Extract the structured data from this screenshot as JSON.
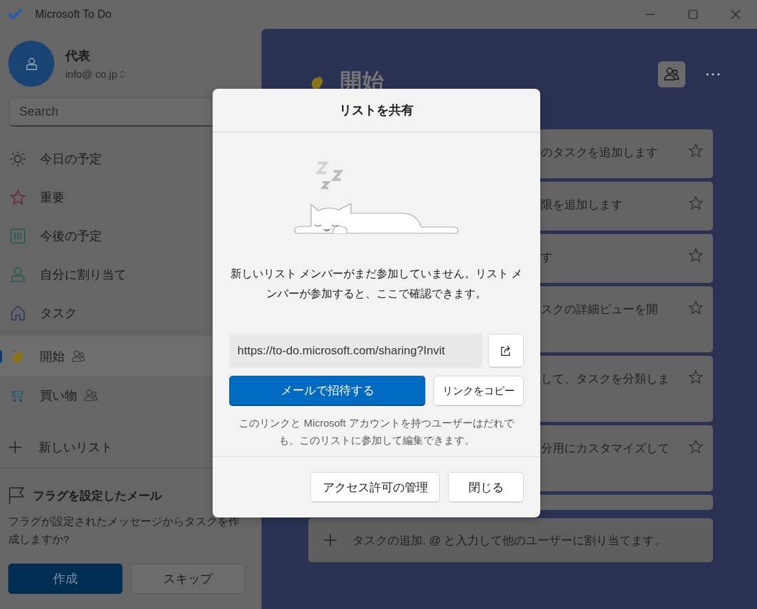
{
  "window": {
    "title": "Microsoft To Do"
  },
  "sidebar": {
    "account": {
      "name": "代表",
      "email": "info@ co.jp"
    },
    "search": {
      "placeholder": "Search"
    },
    "items": [
      {
        "kind": "sun",
        "label": "今日の予定",
        "selected": false,
        "shared": false
      },
      {
        "kind": "star",
        "label": "重要",
        "selected": false,
        "shared": false
      },
      {
        "kind": "calendar",
        "label": "今後の予定",
        "selected": false,
        "shared": false
      },
      {
        "kind": "person",
        "label": "自分に割り当て",
        "selected": false,
        "shared": false
      },
      {
        "kind": "home",
        "label": "タスク",
        "selected": false,
        "shared": false
      },
      {
        "kind": "wave",
        "label": "開始",
        "selected": true,
        "shared": true
      },
      {
        "kind": "cart",
        "label": "買い物",
        "selected": false,
        "shared": true
      }
    ],
    "new_list": "新しいリスト",
    "flagged": {
      "title": "フラグを設定したメール",
      "message": "フラグが設定されたメッセージからタスクを作成しますか?",
      "buttons": [
        {
          "label": "作成",
          "primary": true
        },
        {
          "label": "スキップ",
          "primary": false
        }
      ]
    }
  },
  "main": {
    "title": "開始",
    "tasks": [
      {
        "text": "のタスクを追加します"
      },
      {
        "text": "限を追加します"
      },
      {
        "text": "す"
      },
      {
        "text": "スクの詳細ビューを開"
      },
      {
        "text": "して、タスクを分類しま"
      },
      {
        "text": "分用にカスタマイズして"
      }
    ],
    "add_task": "タスクの追加. @ と入力して他のユーザーに割り当てます。"
  },
  "dialog": {
    "title": "リストを共有",
    "message": "新しいリスト メンバーがまだ参加していません。リスト メンバーが参加すると、ここで確認できます。",
    "link": "https://to-do.microsoft.com/sharing?Invit",
    "invite_button": "メールで招待する",
    "copy_button": "リンクをコピー",
    "note": "このリンクと Microsoft アカウントを持つユーザーはだれでも、このリストに参加して編集できます。",
    "footer_buttons": [
      "アクセス許可の管理",
      "閉じる"
    ]
  }
}
